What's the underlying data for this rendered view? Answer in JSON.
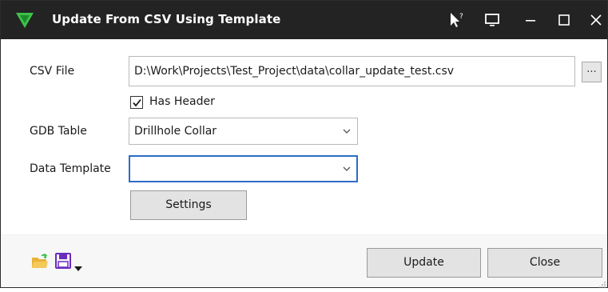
{
  "window": {
    "title": "Update From CSV Using Template"
  },
  "form": {
    "csv_label": "CSV File",
    "csv_value": "D:\\Work\\Projects\\Test_Project\\data\\collar_update_test.csv",
    "browse_label": "...",
    "has_header_label": "Has Header",
    "has_header_checked": true,
    "gdb_label": "GDB Table",
    "gdb_value": "Drillhole Collar",
    "template_label": "Data Template",
    "template_value": "",
    "settings_label": "Settings"
  },
  "footer": {
    "update_label": "Update",
    "close_label": "Close"
  },
  "icons": {
    "logo": "app-logo-icon",
    "help": "help-pointer-icon",
    "monitor": "monitor-icon",
    "minimize": "minimize-icon",
    "maximize": "maximize-icon",
    "close": "close-icon",
    "open": "folder-open-icon",
    "save": "save-icon",
    "dropdown": "chevron-down-icon"
  },
  "colors": {
    "titlebar": "#232323",
    "logo_green": "#3cc24a",
    "focus_border": "#2d6dc6",
    "save_purple": "#6b2bbf",
    "folder_yellow": "#e8b23a"
  }
}
